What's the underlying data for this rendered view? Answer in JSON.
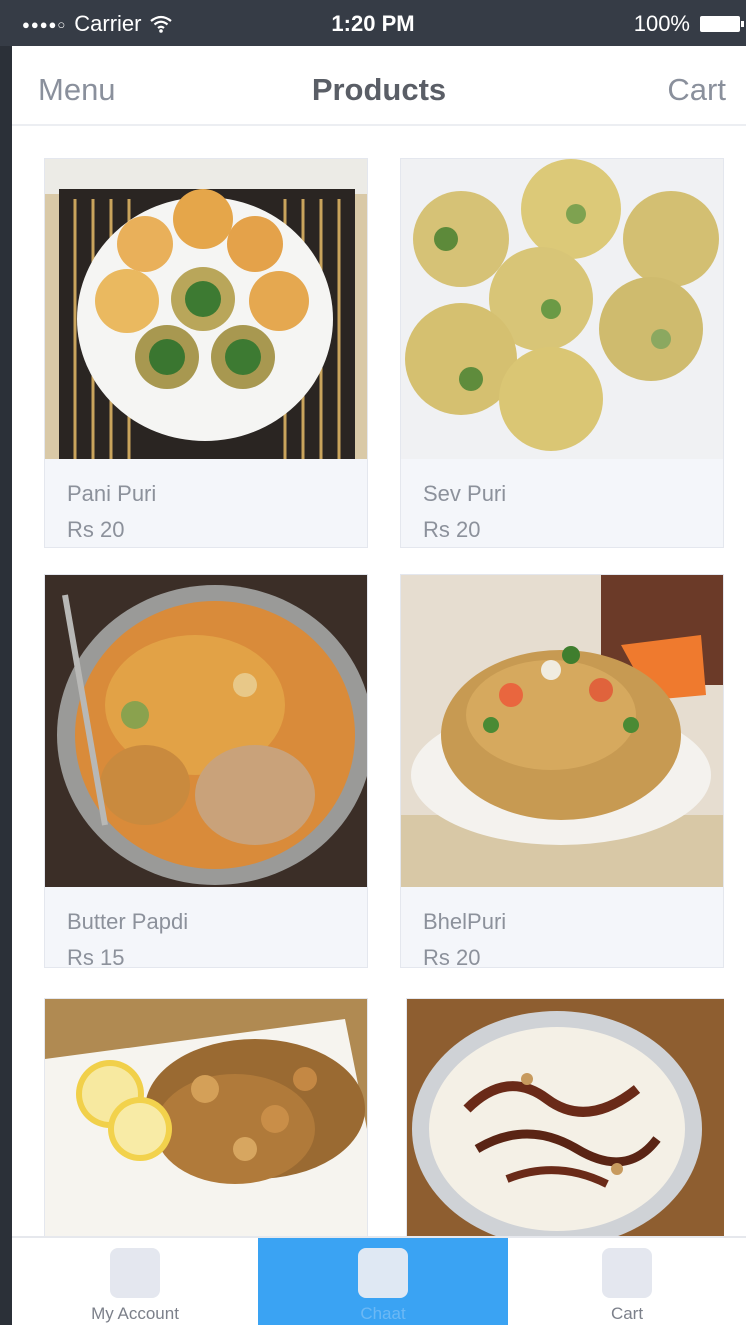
{
  "status_bar": {
    "signal_dots": "●●●●○",
    "carrier": "Carrier",
    "wifi_icon": "wifi-icon",
    "time": "1:20 PM",
    "battery_percent": "100%",
    "battery_icon": "battery-full-icon"
  },
  "nav": {
    "menu_label": "Menu",
    "title": "Products",
    "cart_label": "Cart"
  },
  "products": [
    {
      "name": "Pani Puri",
      "price": "Rs 20"
    },
    {
      "name": "Sev Puri",
      "price": "Rs 20"
    },
    {
      "name": "Butter Papdi",
      "price": "Rs 15"
    },
    {
      "name": "BhelPuri",
      "price": "Rs 20"
    },
    {
      "name": "",
      "price": ""
    },
    {
      "name": "",
      "price": ""
    }
  ],
  "tabs": [
    {
      "label": "My Account",
      "icon": "account-icon",
      "active": false
    },
    {
      "label": "Chaat",
      "icon": "chaat-icon",
      "active": true
    },
    {
      "label": "Cart",
      "icon": "cart-icon",
      "active": false
    }
  ],
  "colors": {
    "status_bar": "#363c46",
    "active_tab": "#3aa3f3",
    "card_background": "#f4f6fa"
  }
}
